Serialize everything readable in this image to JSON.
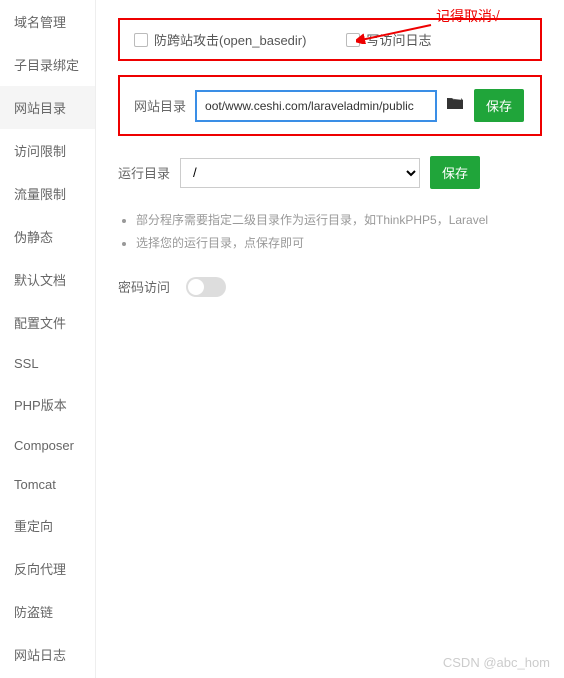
{
  "sidebar": {
    "items": [
      {
        "label": "域名管理"
      },
      {
        "label": "子目录绑定"
      },
      {
        "label": "网站目录"
      },
      {
        "label": "访问限制"
      },
      {
        "label": "流量限制"
      },
      {
        "label": "伪静态"
      },
      {
        "label": "默认文档"
      },
      {
        "label": "配置文件"
      },
      {
        "label": "SSL"
      },
      {
        "label": "PHP版本"
      },
      {
        "label": "Composer"
      },
      {
        "label": "Tomcat"
      },
      {
        "label": "重定向"
      },
      {
        "label": "反向代理"
      },
      {
        "label": "防盗链"
      },
      {
        "label": "网站日志"
      }
    ],
    "active_index": 2
  },
  "annotation": {
    "text": "记得取消√"
  },
  "checkboxes": {
    "open_basedir": "防跨站攻击(open_basedir)",
    "access_log": "写访问日志"
  },
  "site_dir": {
    "label": "网站目录",
    "value": "oot/www.ceshi.com/laraveladmin/public",
    "save": "保存"
  },
  "run_dir": {
    "label": "运行目录",
    "value": "/",
    "save": "保存"
  },
  "notes": {
    "line1": "部分程序需要指定二级目录作为运行目录，如ThinkPHP5，Laravel",
    "line2": "选择您的运行目录，点保存即可"
  },
  "password_access": {
    "label": "密码访问"
  },
  "watermark": "CSDN @abc_hom"
}
